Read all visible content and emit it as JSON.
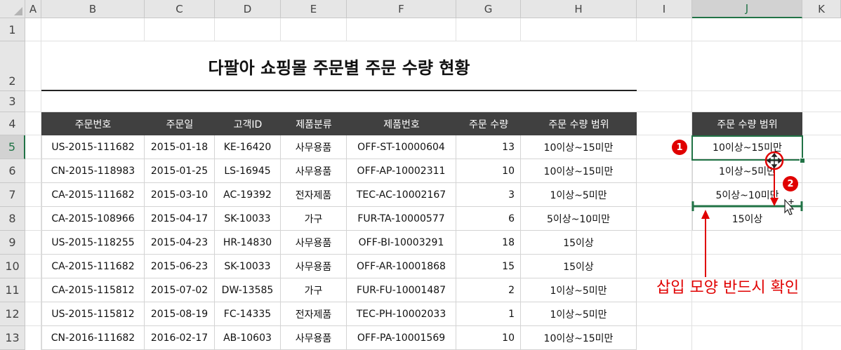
{
  "columns": [
    "A",
    "B",
    "C",
    "D",
    "E",
    "F",
    "G",
    "H",
    "I",
    "J",
    "K"
  ],
  "selected_column": "J",
  "rows": [
    "1",
    "2",
    "3",
    "4",
    "5",
    "6",
    "7",
    "8",
    "9",
    "10",
    "11",
    "12",
    "13"
  ],
  "selected_row": "5",
  "title": "다팔아 쇼핑몰 주문별 주문 수량 현황",
  "table": {
    "headers": [
      "주문번호",
      "주문일",
      "고객ID",
      "제품분류",
      "제품번호",
      "주문 수량",
      "주문 수량 범위"
    ],
    "rows": [
      [
        "US-2015-111682",
        "2015-01-18",
        "KE-16420",
        "사무용품",
        "OFF-ST-10000604",
        "13",
        "10이상~15미만"
      ],
      [
        "CN-2015-118983",
        "2015-01-25",
        "LS-16945",
        "사무용품",
        "OFF-AP-10002311",
        "10",
        "10이상~15미만"
      ],
      [
        "CA-2015-111682",
        "2015-03-10",
        "AC-19392",
        "전자제품",
        "TEC-AC-10002167",
        "3",
        "1이상~5미만"
      ],
      [
        "CA-2015-108966",
        "2015-04-17",
        "SK-10033",
        "가구",
        "FUR-TA-10000577",
        "6",
        "5이상~10미만"
      ],
      [
        "US-2015-118255",
        "2015-04-23",
        "HR-14830",
        "사무용품",
        "OFF-BI-10003291",
        "18",
        "15이상"
      ],
      [
        "CA-2015-111682",
        "2015-06-23",
        "SK-10033",
        "사무용품",
        "OFF-AR-10001868",
        "15",
        "15이상"
      ],
      [
        "CA-2015-115812",
        "2015-07-02",
        "DW-13585",
        "가구",
        "FUR-FU-10001487",
        "2",
        "1이상~5미만"
      ],
      [
        "US-2015-115812",
        "2015-08-19",
        "FC-14335",
        "전자제품",
        "TEC-PH-10002033",
        "1",
        "1이상~5미만"
      ],
      [
        "CN-2016-111682",
        "2016-02-17",
        "AB-10603",
        "사무용품",
        "OFF-PA-10001569",
        "10",
        "10이상~15미만"
      ]
    ]
  },
  "range_table": {
    "header": "주문 수량 범위",
    "items": [
      "10이상~15미만",
      "1이상~5미만",
      "5이상~10미만",
      "15이상"
    ]
  },
  "badges": [
    "1",
    "2"
  ],
  "note": "삽입 모양 반드시 확인",
  "colors": {
    "header_bg": "#404040",
    "excel_green": "#217346",
    "accent_red": "#e00000"
  }
}
